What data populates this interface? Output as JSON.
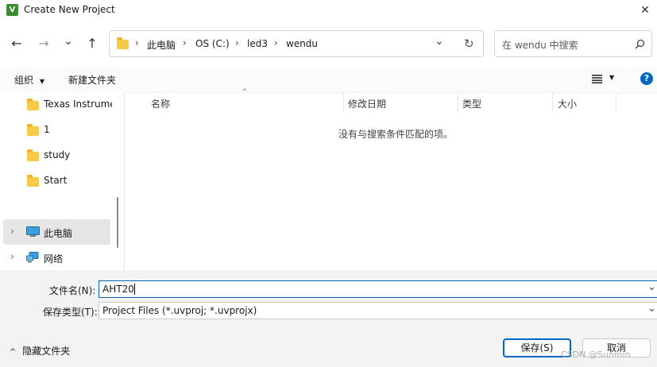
{
  "window": {
    "title": "Create New Project",
    "close": "✕"
  },
  "nav": {
    "back": "←",
    "forward": "→",
    "recent": "⌄",
    "up": "↑",
    "breadcrumb": [
      "此电脑",
      "OS (C:)",
      "led3",
      "wendu"
    ],
    "sep": "›",
    "dropdown": "⌄",
    "refresh": "↻"
  },
  "search": {
    "placeholder": "在 wendu 中搜索"
  },
  "toolbar": {
    "organize": "组织",
    "organize_caret": "▼",
    "new_folder": "新建文件夹",
    "view_caret": "▼",
    "help": "?"
  },
  "sidebar": {
    "items": [
      {
        "label": "Texas Instrume"
      },
      {
        "label": "1"
      },
      {
        "label": "study"
      },
      {
        "label": "Start"
      },
      {
        "label": "此电脑"
      },
      {
        "label": "网络"
      }
    ],
    "expander": "›"
  },
  "list": {
    "columns": [
      "名称",
      "修改日期",
      "类型",
      "大小"
    ],
    "sort_indicator": "^",
    "empty_message": "没有与搜索条件匹配的项。"
  },
  "form": {
    "filename_label": "文件名(N):",
    "filename_value": "AHT20",
    "filetype_label": "保存类型(T):",
    "filetype_value": "Project Files (*.uvproj; *.uvprojx)",
    "caret": "⌄"
  },
  "footer": {
    "hide_folders": "隐藏文件夹",
    "hide_caret": "^",
    "save": "保存(S)",
    "cancel": "取消",
    "watermark": "CSDN @Sunmin"
  },
  "colors": {
    "accent": "#0067c0",
    "selection": "#e5e5e5",
    "folder": "#f7c948"
  }
}
